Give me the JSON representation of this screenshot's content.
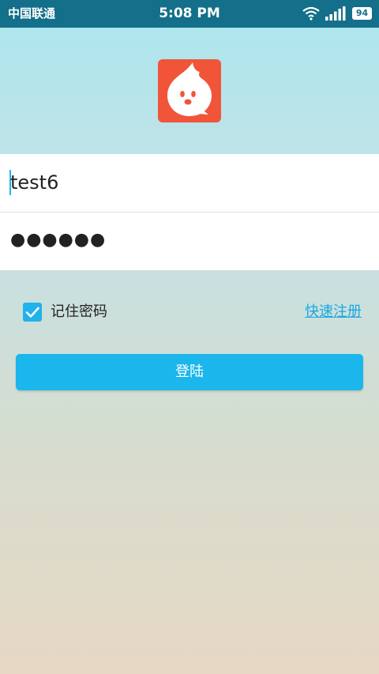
{
  "status_bar": {
    "carrier": "中国联通",
    "time": "5:08 PM",
    "battery": "94"
  },
  "login_form": {
    "username_value": "test6",
    "password_mask": "●●●●●●",
    "remember_label": "记住密码",
    "remember_checked": true,
    "register_link": "快速注册",
    "login_button": "登陆"
  },
  "colors": {
    "status_bar": "#136f8a",
    "accent": "#1ab6ec",
    "logo": "#f0553a"
  },
  "icons": {
    "logo": "app-logo-icon",
    "wifi": "wifi-icon",
    "signal": "signal-icon",
    "checkbox": "checkmark-icon"
  }
}
